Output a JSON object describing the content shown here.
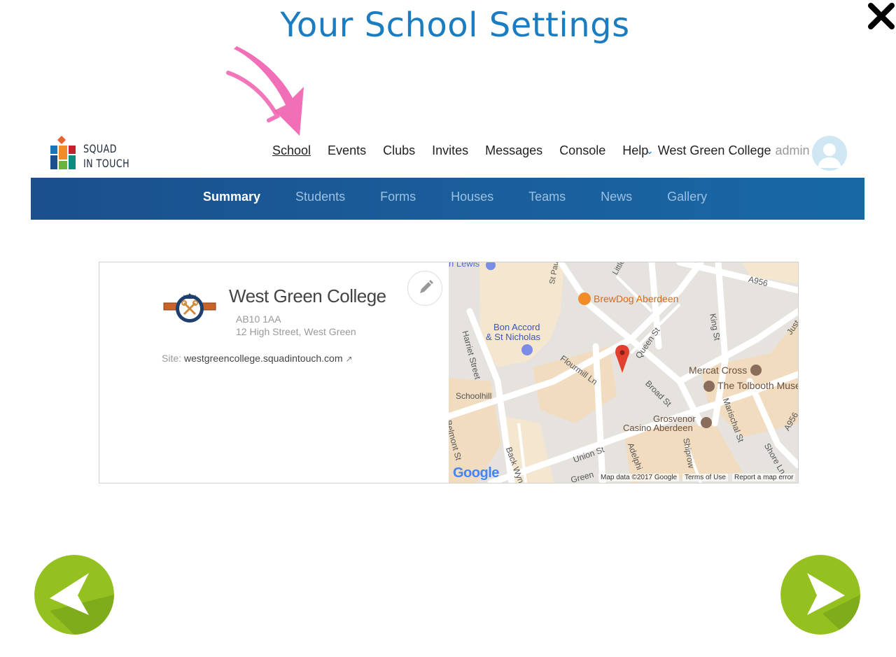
{
  "page_title": "Your School Settings",
  "brand": {
    "line1": "SQUAD",
    "line2": "IN TOUCH"
  },
  "nav": {
    "items": [
      "School",
      "Events",
      "Clubs",
      "Invites",
      "Messages",
      "Console",
      "Help"
    ],
    "active": "School"
  },
  "school_switcher": {
    "school": "West Green College",
    "role": "admin"
  },
  "subnav": {
    "tabs": [
      "Summary",
      "Students",
      "Forms",
      "Houses",
      "Teams",
      "News",
      "Gallery"
    ],
    "active": "Summary"
  },
  "school_card": {
    "name": "West Green College",
    "postcode": "AB10 1AA",
    "address": "12 High Street, West Green",
    "site_label": "Site:",
    "site_url": "westgreencollege.squadintouch.com"
  },
  "map": {
    "labels": {
      "lewis": "n Lewis",
      "st_paul": "St Paul St",
      "little": "Little",
      "a956_top": "A956",
      "brewdog": "BrewDog Aberdeen",
      "bon_accord_1": "Bon Accord",
      "bon_accord_2": "& St Nicholas",
      "harriet": "Harriet Street",
      "flourmill": "Flourmill Ln",
      "queen": "Queen St",
      "king": "King St",
      "just": "Just",
      "mercat": "Mercat Cross",
      "tolbooth": "The Tolbooth Muse",
      "broad": "Broad St",
      "schoolhill": "Schoolhill",
      "grosvenor_1": "Grosvenor",
      "grosvenor_2": "Casino Aberdeen",
      "marischal": "Marischal St",
      "a956_right": "A956",
      "belmont": "Belmont St",
      "back_wynd": "Back Wynd",
      "union": "Union St",
      "adelphi": "Adelphi",
      "shiprow": "Shiprow",
      "shore": "Shore Ln",
      "green": "Green"
    },
    "google": "Google",
    "map_data": "Map data ©2017 Google",
    "terms": "Terms of Use",
    "report": "Report a map error"
  },
  "colors": {
    "title_blue": "#1a7cc1",
    "subnav_blue": "#1a5d9a",
    "arrow_pink": "#ee5fae",
    "nav_green": "#8fc021"
  }
}
